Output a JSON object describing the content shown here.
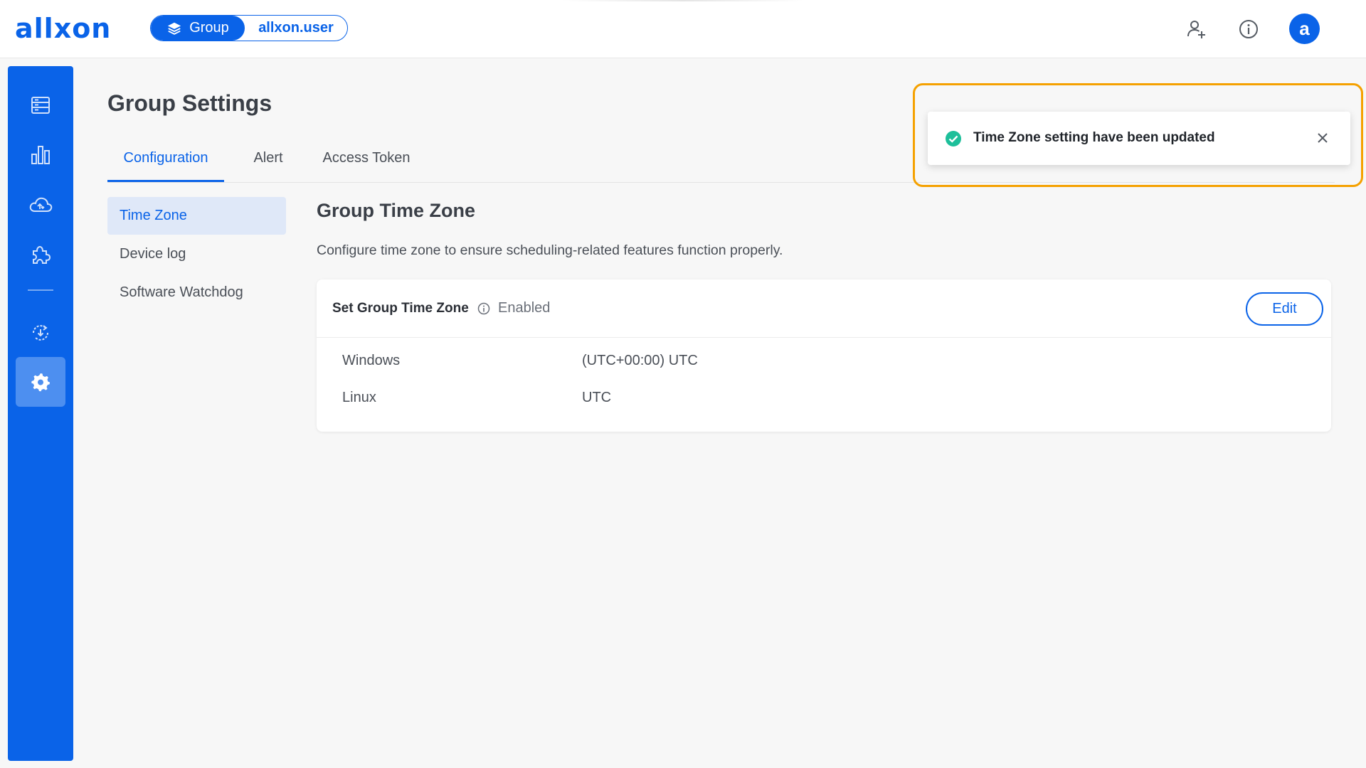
{
  "brand": {
    "logo_text": "allxon"
  },
  "context": {
    "group_label": "Group",
    "user_label": "allxon.user"
  },
  "topbar": {
    "icons": [
      "add-user-icon",
      "info-icon"
    ],
    "avatar_letter": "a"
  },
  "sidebar": {
    "items": [
      {
        "icon": "devices-icon",
        "active": false
      },
      {
        "icon": "analytics-icon",
        "active": false
      },
      {
        "icon": "cloud-sync-icon",
        "active": false
      },
      {
        "icon": "plugin-icon",
        "active": false
      },
      {
        "icon": "ota-update-icon",
        "active": false
      },
      {
        "icon": "settings-icon",
        "active": true
      }
    ]
  },
  "page": {
    "title": "Group Settings"
  },
  "tabs": [
    {
      "label": "Configuration",
      "active": true
    },
    {
      "label": "Alert",
      "active": false
    },
    {
      "label": "Access Token",
      "active": false
    }
  ],
  "subnav": [
    {
      "label": "Time Zone",
      "active": true
    },
    {
      "label": "Device log",
      "active": false
    },
    {
      "label": "Software Watchdog",
      "active": false
    }
  ],
  "section": {
    "title": "Group Time Zone",
    "description": "Configure time zone to ensure scheduling-related features function properly."
  },
  "card": {
    "title": "Set Group Time Zone",
    "status": "Enabled",
    "edit_label": "Edit",
    "rows": [
      {
        "key": "Windows",
        "value": "(UTC+00:00) UTC"
      },
      {
        "key": "Linux",
        "value": "UTC"
      }
    ]
  },
  "toast": {
    "message": "Time Zone setting have been updated",
    "status_color": "#1dbf9a",
    "highlight_color": "#f5a100"
  },
  "colors": {
    "accent": "#0a63e8",
    "sidebar_active": "#4d8ff0"
  }
}
